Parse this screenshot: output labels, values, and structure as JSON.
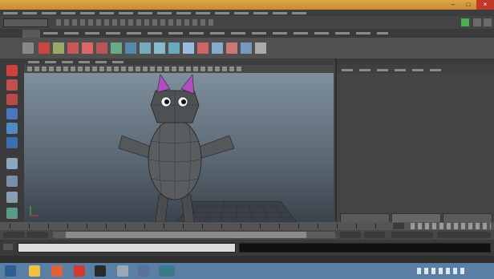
{
  "window": {
    "title": ""
  },
  "viewport": {
    "axis_label": ""
  },
  "attribute_editor": {
    "title": "",
    "message": "",
    "buttons": [
      "",
      "",
      ""
    ]
  },
  "help_line": {
    "text": ""
  },
  "taskbar": {
    "time": "",
    "date": ""
  }
}
